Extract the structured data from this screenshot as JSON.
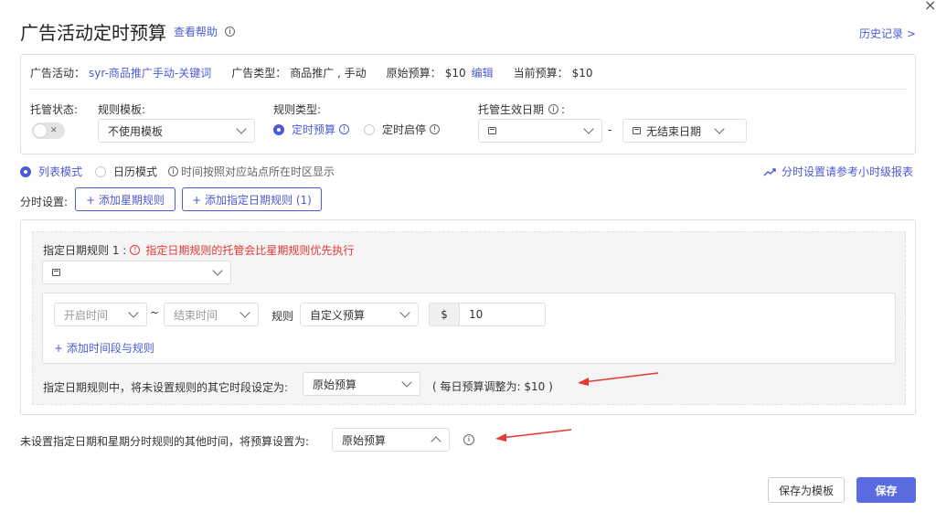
{
  "dialog": {
    "title": "广告活动定时预算",
    "help_link": "查看帮助",
    "history_link": "历史记录 >",
    "close_symbol": "×"
  },
  "campaign_info": {
    "campaign_label": "广告活动：",
    "campaign_value": "syr-商品推广手动-关键词",
    "type_label": "广告类型：",
    "type_value": "商品推广 , 手动",
    "original_budget_label": "原始预算：",
    "original_budget_value": "$10",
    "edit_link": "编辑",
    "current_budget_label": "当前预算：",
    "current_budget_value": "$10"
  },
  "settings": {
    "status_label": "托管状态:",
    "toggle_symbol": "✕",
    "template_label": "规则模板:",
    "template_value": "不使用模板",
    "rule_type_label": "规则类型:",
    "rule_type_options": [
      "定时预算",
      "定时启停"
    ],
    "effective_date_label": "托管生效日期",
    "effective_date_suffix": ":",
    "date_separator": "-",
    "end_date_value": "无结束日期"
  },
  "mode": {
    "list_mode": "列表模式",
    "calendar_mode": "日历模式",
    "timezone_note": "时间按照对应站点所在时区显示",
    "report_link": "分时设置请参考小时级报表"
  },
  "time_settings": {
    "label": "分时设置:",
    "add_weekly_rule": "+ 添加星期规则",
    "add_date_rule": "+ 添加指定日期规则 (1)"
  },
  "date_rule": {
    "title": "指定日期规则 1 :",
    "warning": "指定日期规则的托管会比星期规则优先执行",
    "start_time_placeholder": "开启时间",
    "tilde": "~",
    "end_time_placeholder": "结束时间",
    "rule_label": "规则",
    "rule_value": "自定义预算",
    "currency": "$",
    "amount": "10",
    "add_period": "+ 添加时间段与规则",
    "unset_label": "指定日期规则中，将未设置规则的其它时段设定为:",
    "unset_value": "原始预算",
    "daily_note": "( 每日预算调整为:  $10 )"
  },
  "other_time": {
    "label": "未设置指定日期和星期分时规则的其他时间，将预算设置为:",
    "value": "原始预算"
  },
  "footer": {
    "save_template": "保存为模板",
    "save": "保存"
  },
  "colors": {
    "accent": "#4a5bd4",
    "warning": "#e53935",
    "arrow": "#e53935"
  }
}
